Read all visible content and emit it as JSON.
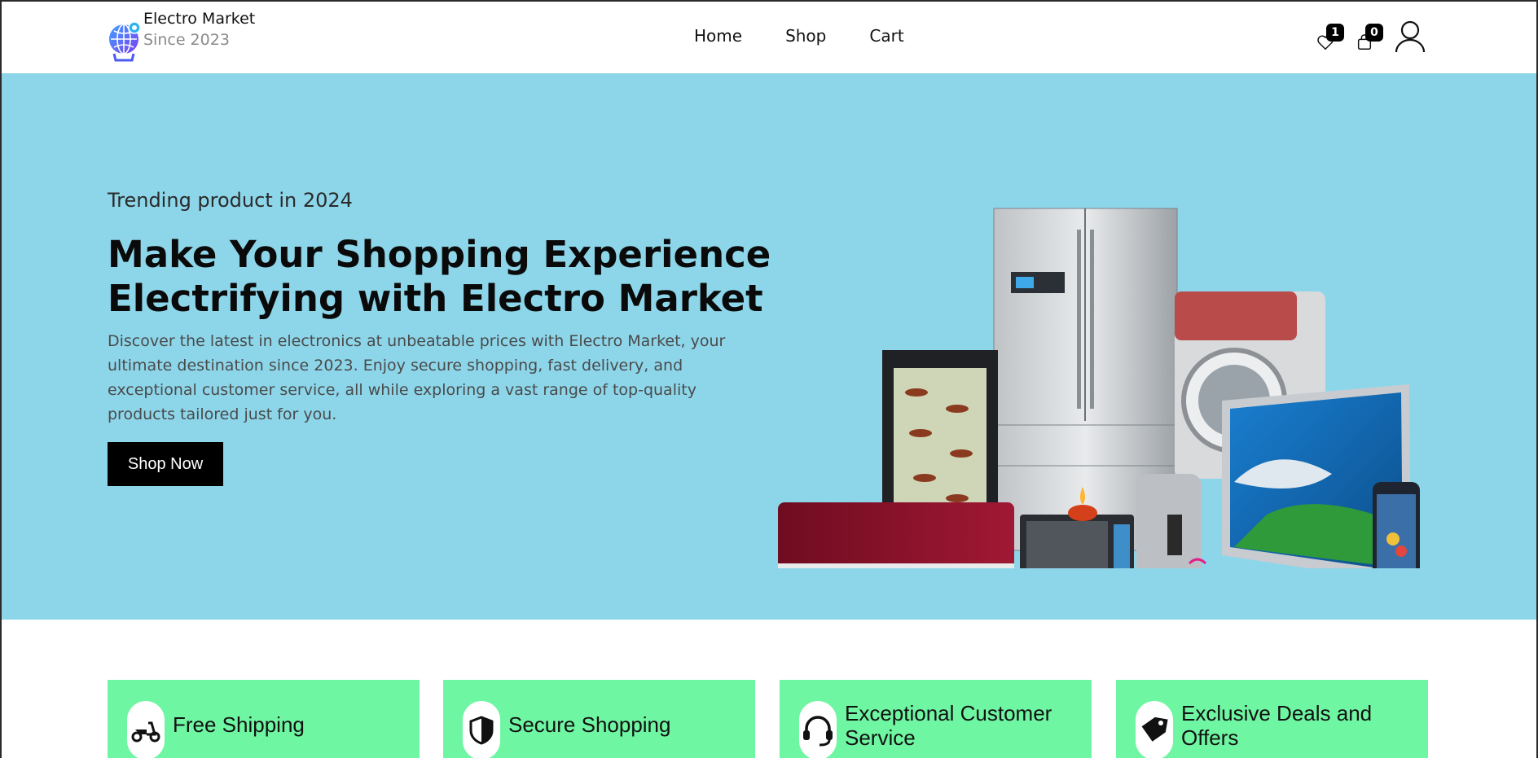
{
  "header": {
    "brand_name": "Electro Market",
    "brand_since": "Since 2023",
    "nav": [
      "Home",
      "Shop",
      "Cart"
    ],
    "wishlist_count": "1",
    "cart_count": "0"
  },
  "hero": {
    "subtitle": "Trending product in 2024",
    "title": "Make Your Shopping Experience Electrifying with Electro Market",
    "description": "Discover the latest in electronics at unbeatable prices with Electro Market, your ultimate destination since 2023. Enjoy secure shopping, fast delivery, and exceptional customer service, all while exploring a vast range of top-quality products tailored just for you.",
    "cta_label": "Shop Now",
    "background_color": "#8dd6ea"
  },
  "features": [
    {
      "label": "Free Shipping",
      "icon": "scooter-icon"
    },
    {
      "label": "Secure Shopping",
      "icon": "shield-icon"
    },
    {
      "label": "Exceptional Customer Service",
      "icon": "headset-icon"
    },
    {
      "label": "Exclusive Deals and Offers",
      "icon": "tag-icon"
    }
  ],
  "colors": {
    "feature_bg": "#6ff6a2",
    "button_bg": "#000000"
  }
}
